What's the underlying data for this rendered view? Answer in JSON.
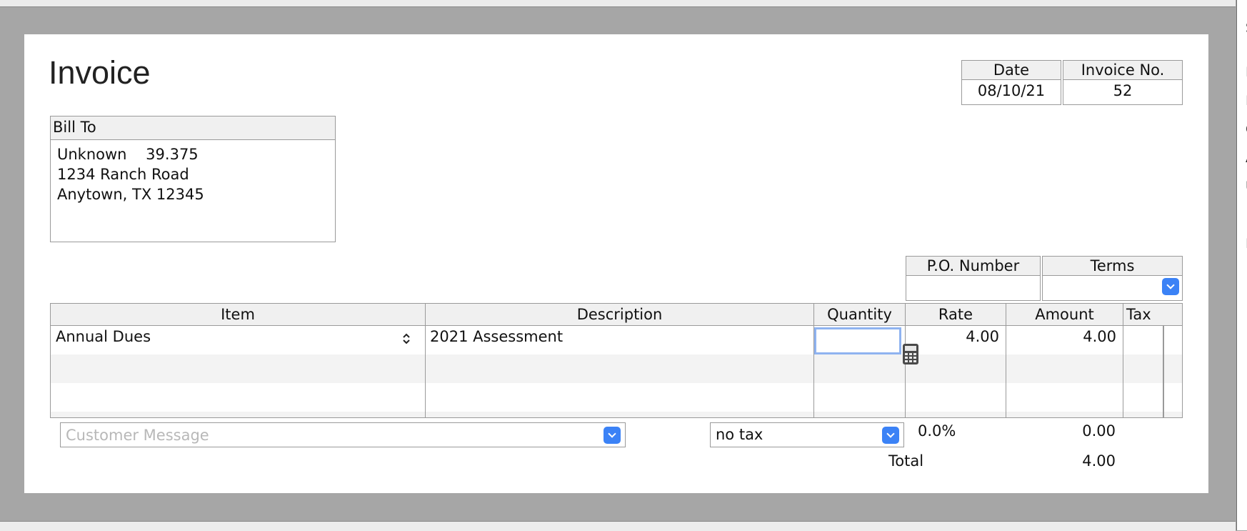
{
  "invoice": {
    "title": "Invoice",
    "date_label": "Date",
    "date_value": "08/10/21",
    "number_label": "Invoice No.",
    "number_value": "52",
    "bill_to_label": "Bill To",
    "bill_to_lines": [
      "Unknown    39.375",
      "1234 Ranch Road",
      "Anytown, TX 12345"
    ],
    "po_label": "P.O. Number",
    "po_value": "",
    "terms_label": "Terms",
    "terms_value": ""
  },
  "table": {
    "columns": [
      "Item",
      "Description",
      "Quantity",
      "Rate",
      "Amount",
      "Tax"
    ],
    "rows": [
      {
        "item": "Annual Dues",
        "description": "2021 Assessment",
        "quantity": "",
        "rate": "4.00",
        "amount": "4.00",
        "tax": ""
      }
    ]
  },
  "footer": {
    "customer_message_placeholder": "Customer Message",
    "tax_select_value": "no tax",
    "tax_rate": "0.0%",
    "tax_amount": "0.00",
    "total_label": "Total",
    "total_value": "4.00"
  },
  "right_strip_glyphs": [
    "S",
    "I",
    "I",
    "C",
    "A",
    "U",
    "I"
  ],
  "icons": {
    "item_stepper": "up-down-chevron-icon",
    "calculator": "calculator-icon",
    "dropdown": "chevron-down-icon"
  },
  "colors": {
    "accent": "#3b82f6",
    "focus_ring": "#8fb3f0",
    "background": "#a6a6a6",
    "header_fill": "#f0f0f0"
  }
}
